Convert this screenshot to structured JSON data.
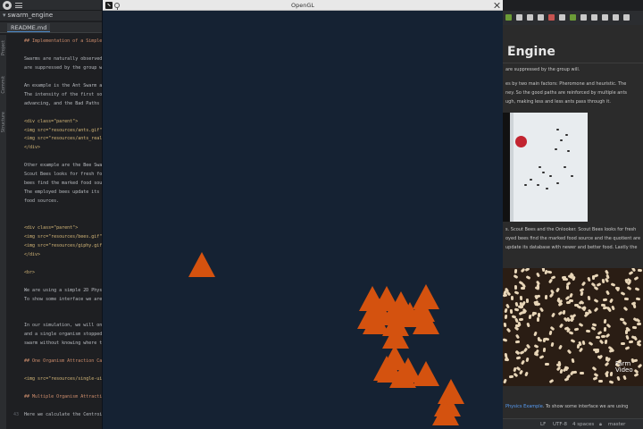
{
  "ide": {
    "project": "swarm_engine",
    "file_tab": "README.md",
    "tool_stripe": [
      "Project",
      "Commit",
      "Structure"
    ],
    "code_lines": [
      {
        "n": "",
        "text": "## Implementation of a Simple (",
        "cls": "head"
      },
      {
        "n": "",
        "text": "",
        "cls": ""
      },
      {
        "n": "",
        "text": "Swarms are naturally observed",
        "cls": ""
      },
      {
        "n": "",
        "text": "are suppressed by the group w",
        "cls": ""
      },
      {
        "n": "",
        "text": "",
        "cls": ""
      },
      {
        "n": "",
        "text": "An example is the Ant Swarm a",
        "cls": ""
      },
      {
        "n": "",
        "text": "The intensity of the first so",
        "cls": ""
      },
      {
        "n": "",
        "text": "advancing, and the Bad Paths a",
        "cls": ""
      },
      {
        "n": "",
        "text": "",
        "cls": ""
      },
      {
        "n": "",
        "text": "<div class=\"parent\">",
        "cls": "tag"
      },
      {
        "n": "",
        "text": "<img src=\"resources/ants.gif\"",
        "cls": "tag"
      },
      {
        "n": "",
        "text": "<img src=\"resources/ants_real",
        "cls": "tag"
      },
      {
        "n": "",
        "text": "</div>",
        "cls": "tag"
      },
      {
        "n": "",
        "text": "",
        "cls": ""
      },
      {
        "n": "",
        "text": "Other example are the Bee Swar",
        "cls": ""
      },
      {
        "n": "",
        "text": "Scout Bees looks for fresh foo",
        "cls": ""
      },
      {
        "n": "",
        "text": "bees find the marked food sour",
        "cls": ""
      },
      {
        "n": "",
        "text": "The employed bees update its d",
        "cls": ""
      },
      {
        "n": "",
        "text": "food sources.",
        "cls": ""
      },
      {
        "n": "",
        "text": "",
        "cls": ""
      },
      {
        "n": "",
        "text": "",
        "cls": ""
      },
      {
        "n": "",
        "text": "<div class=\"parent\">",
        "cls": "tag"
      },
      {
        "n": "",
        "text": "<img src=\"resources/bees.gif\"",
        "cls": "tag"
      },
      {
        "n": "",
        "text": "<img src=\"resources/giphy.gif\"",
        "cls": "tag"
      },
      {
        "n": "",
        "text": "</div>",
        "cls": "tag"
      },
      {
        "n": "",
        "text": "",
        "cls": ""
      },
      {
        "n": "",
        "text": "<br>",
        "cls": "tag"
      },
      {
        "n": "",
        "text": "",
        "cls": ""
      },
      {
        "n": "",
        "text": "We are using a simple 2D Physi",
        "cls": ""
      },
      {
        "n": "",
        "text": "To show some interface we are",
        "cls": ""
      },
      {
        "n": "",
        "text": "",
        "cls": ""
      },
      {
        "n": "",
        "text": "",
        "cls": ""
      },
      {
        "n": "",
        "text": "In our simulation, we will on",
        "cls": ""
      },
      {
        "n": "",
        "text": "and a single organism stopped",
        "cls": ""
      },
      {
        "n": "",
        "text": "swarm without knowing where t",
        "cls": ""
      },
      {
        "n": "",
        "text": "",
        "cls": ""
      },
      {
        "n": "",
        "text": "## One Organism Attraction Ca",
        "cls": "head"
      },
      {
        "n": "",
        "text": "",
        "cls": ""
      },
      {
        "n": "",
        "text": "<img src=\"resources/single-ui",
        "cls": "tag"
      },
      {
        "n": "",
        "text": "",
        "cls": ""
      },
      {
        "n": "",
        "text": "## Multiple Organism Attracti",
        "cls": "head"
      },
      {
        "n": "",
        "text": "",
        "cls": ""
      },
      {
        "n": "43",
        "text": "Here we calculate the Centroi",
        "cls": ""
      }
    ]
  },
  "gl_window": {
    "title": "OpenGL",
    "background_color": "#152233",
    "agent_color": "#d4520f",
    "agent_count": 23
  },
  "preview": {
    "title": "Engine",
    "line1": "are suppressed by the group will.",
    "para1": [
      "es by two main factors: Pheromone and heuristic. The",
      "ney. So the good paths are reinforced by multiple ants",
      "ugh, making less and less ants pass through it."
    ],
    "para2": [
      "s. Scout Bees and the Onlooker. Scout Bees looks for fresh",
      "oyed bees find the marked food source and the quotient are",
      "update its database with newer and better food. Lastly the"
    ],
    "bees_watermark": [
      "Farm",
      "Video"
    ],
    "physics_prefix": "",
    "physics_link": "Physics Example",
    "physics_suffix": ". To show some interface we are using"
  },
  "status_bar": {
    "line_sep": "LF",
    "encoding": "UTF-8",
    "indent": "4 spaces",
    "branch": "master"
  },
  "toolbar_colors": [
    "#6b9b37",
    "#c9c9c9",
    "#c9c9c9",
    "#c9c9c9",
    "#c75450",
    "#c9c9c9",
    "#6b9b37",
    "#c9c9c9",
    "#c9c9c9",
    "#c9c9c9",
    "#c9c9c9",
    "#c9c9c9"
  ]
}
